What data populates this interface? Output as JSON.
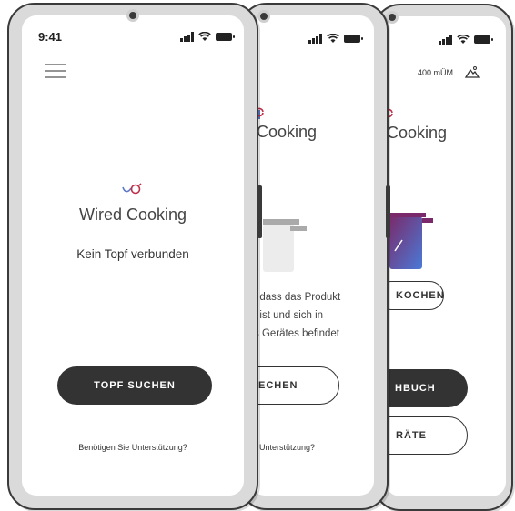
{
  "status": {
    "time": "9:41"
  },
  "app": {
    "brand": "Wired Cooking",
    "brand_partial": "Cooking"
  },
  "screen1": {
    "connection_status": "Kein Topf verbunden",
    "search_button": "TOPF SUCHEN",
    "support_link": "Benötigen Sie Unterstützung?"
  },
  "screen2": {
    "instruction_lines": [
      ", dass das Produkt",
      "t ist und sich in",
      "s Gerätes befindet"
    ],
    "button_partial": "ECHEN",
    "support_partial": "Unterstützung?"
  },
  "screen3": {
    "altitude": "400 mÜM",
    "cook_button_partial": "KOCHEN",
    "cookbook_partial": "HBUCH",
    "devices_partial": "RÄTE"
  },
  "colors": {
    "accent_red": "#c0304a",
    "accent_blue": "#5a78c8",
    "dark": "#333333"
  }
}
